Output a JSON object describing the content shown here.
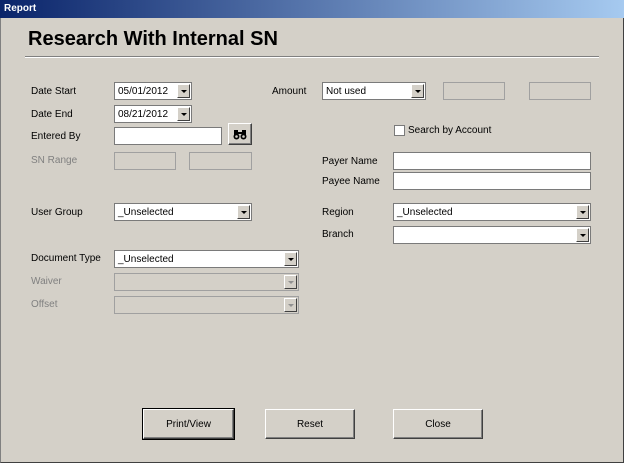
{
  "window": {
    "title": "Report"
  },
  "form": {
    "heading": "Research With Internal SN",
    "date_start": {
      "label": "Date Start",
      "value": "05/01/2012"
    },
    "date_end": {
      "label": "Date End",
      "value": "08/21/2012"
    },
    "entered_by": {
      "label": "Entered By",
      "value": "",
      "find_icon": "binoculars-icon"
    },
    "sn_range": {
      "label": "SN Range",
      "from": "",
      "to": ""
    },
    "amount": {
      "label": "Amount",
      "value": "Not used",
      "from": "",
      "to": ""
    },
    "search_by_account": {
      "label": "Search by Account",
      "checked": false
    },
    "payer_name": {
      "label": "Payer Name",
      "value": ""
    },
    "payee_name": {
      "label": "Payee Name",
      "value": ""
    },
    "user_group": {
      "label": "User Group",
      "value": "_Unselected"
    },
    "region": {
      "label": "Region",
      "value": "_Unselected"
    },
    "branch": {
      "label": "Branch",
      "value": ""
    },
    "document_type": {
      "label": "Document Type",
      "value": "_Unselected"
    },
    "waiver": {
      "label": "Waiver",
      "value": ""
    },
    "offset": {
      "label": "Offset",
      "value": ""
    }
  },
  "buttons": {
    "print_view": "Print/View",
    "reset": "Reset",
    "close": "Close"
  }
}
